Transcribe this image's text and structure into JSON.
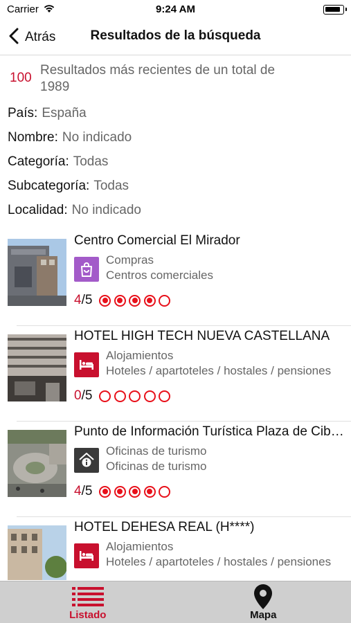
{
  "status_bar": {
    "carrier": "Carrier",
    "time": "9:24 AM"
  },
  "nav": {
    "back_label": "Atrás",
    "title": "Resultados de la búsqueda"
  },
  "summary": {
    "count": "100",
    "text": "Resultados más recientes de un total de 1989"
  },
  "filters": [
    {
      "label": "País:",
      "value": "España"
    },
    {
      "label": "Nombre:",
      "value": "No indicado"
    },
    {
      "label": "Categoría:",
      "value": "Todas"
    },
    {
      "label": "Subcategoría:",
      "value": "Todas"
    },
    {
      "label": "Localidad:",
      "value": "No indicado"
    }
  ],
  "results": [
    {
      "title": "Centro Comercial El Mirador",
      "category": "Compras",
      "subcategory": "Centros comerciales",
      "score": "4",
      "out_of": "/5",
      "rating": 4,
      "icon": "shopping-bag-icon",
      "icon_color": "#a35bc9"
    },
    {
      "title": "HOTEL HIGH TECH NUEVA CASTELLANA",
      "category": "Alojamientos",
      "subcategory": "Hoteles / apartoteles / hostales / pensiones",
      "score": "0",
      "out_of": "/5",
      "rating": 0,
      "icon": "bed-icon",
      "icon_color": "#c8102e"
    },
    {
      "title": "Punto de Información Turística Plaza de Cibeles",
      "category": "Oficinas de turismo",
      "subcategory": "Oficinas de turismo",
      "score": "4",
      "out_of": "/5",
      "rating": 4,
      "icon": "info-house-icon",
      "icon_color": "#3a3a3a"
    },
    {
      "title": "HOTEL DEHESA REAL (H****)",
      "category": "Alojamientos",
      "subcategory": "Hoteles / apartoteles / hostales / pensiones",
      "score": "",
      "out_of": "",
      "rating": 0,
      "icon": "bed-icon",
      "icon_color": "#c8102e"
    }
  ],
  "tabs": [
    {
      "label": "Listado",
      "icon": "list-icon",
      "active": true
    },
    {
      "label": "Mapa",
      "icon": "map-pin-icon",
      "active": false
    }
  ],
  "colors": {
    "accent": "#c8102e",
    "rating": "#e8101a",
    "tab_bar": "#cfcfcf"
  }
}
